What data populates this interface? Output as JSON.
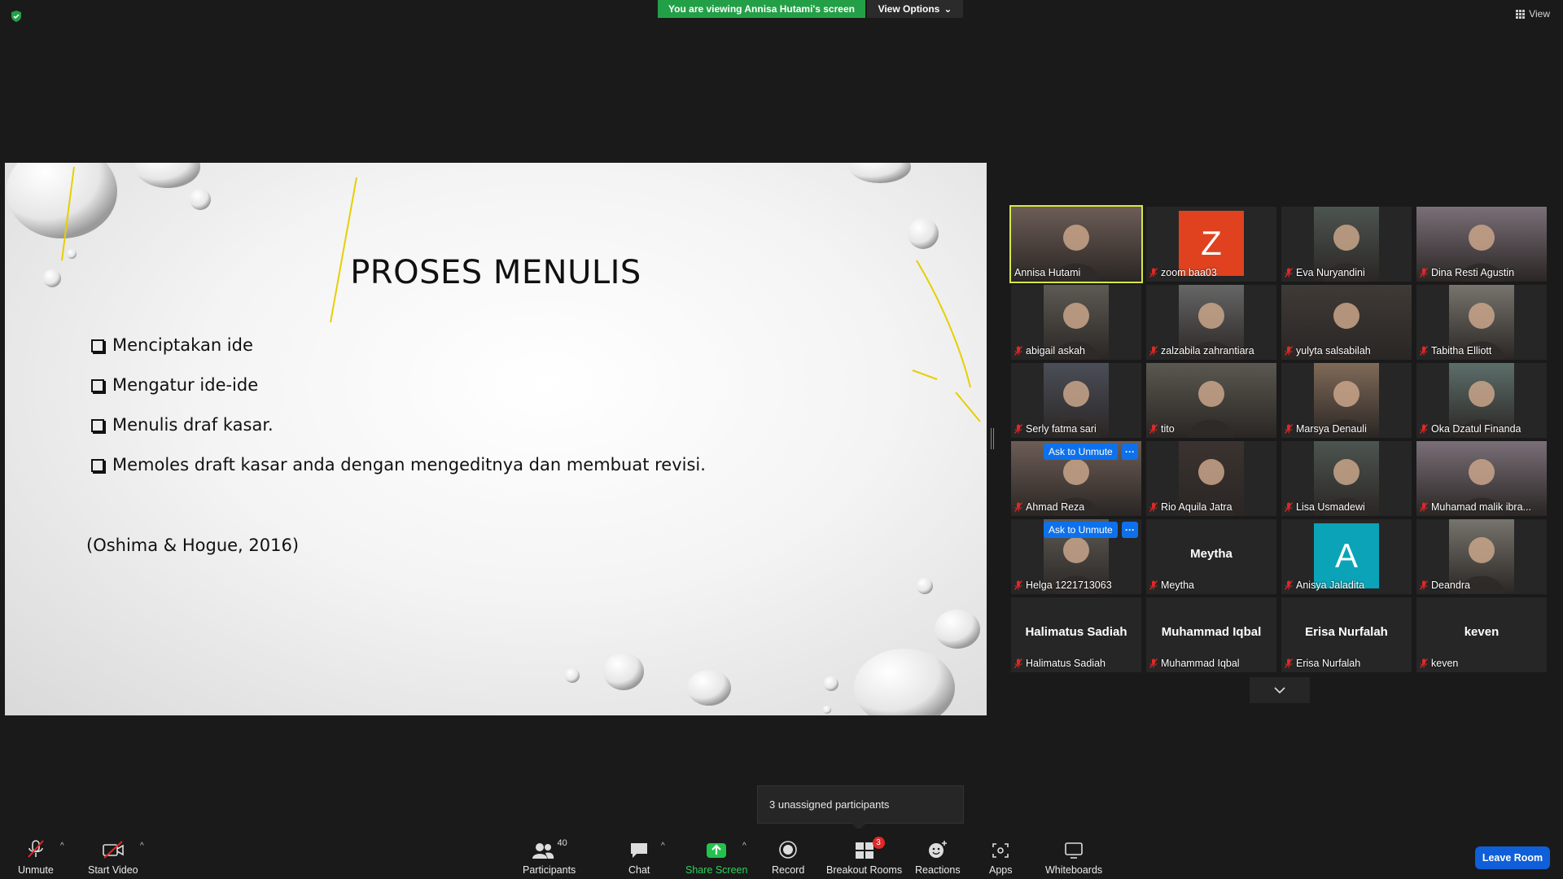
{
  "banner": {
    "viewing": "You are viewing Annisa Hutami's screen",
    "view_options": "View Options",
    "view": "View"
  },
  "slide": {
    "title": "PROSES MENULIS",
    "items": [
      "Menciptakan ide",
      "Mengatur ide-ide",
      "Menulis draf kasar.",
      "Memoles draft kasar anda dengan mengeditnya dan membuat revisi."
    ],
    "citation": "(Oshima & Hogue, 2016)"
  },
  "participants": [
    {
      "name": "Annisa Hutami",
      "kind": "video",
      "active": true
    },
    {
      "name": "zoom baa03",
      "kind": "avatar",
      "letter": "Z",
      "color": "#e0421f"
    },
    {
      "name": "Eva Nuryandini",
      "kind": "video"
    },
    {
      "name": "Dina Resti Agustin",
      "kind": "video"
    },
    {
      "name": "abigail askah",
      "kind": "video"
    },
    {
      "name": "zalzabila zahrantiara",
      "kind": "video"
    },
    {
      "name": "yulyta salsabilah",
      "kind": "video"
    },
    {
      "name": "Tabitha Elliott",
      "kind": "video"
    },
    {
      "name": "Serly fatma sari",
      "kind": "video"
    },
    {
      "name": "tito",
      "kind": "video"
    },
    {
      "name": "Marsya Denauli",
      "kind": "video"
    },
    {
      "name": "Oka Dzatul Finanda",
      "kind": "video"
    },
    {
      "name": "Ahmad Reza",
      "kind": "video",
      "ask_unmute": true
    },
    {
      "name": "Rio Aquila Jatra",
      "kind": "video"
    },
    {
      "name": "Lisa Usmadewi",
      "kind": "video"
    },
    {
      "name": "Muhamad malik ibra...",
      "kind": "video"
    },
    {
      "name": "Helga 1221713063",
      "kind": "video",
      "ask_unmute": true
    },
    {
      "name": "Meytha",
      "kind": "text",
      "display": "Meytha"
    },
    {
      "name": "Anisya Jaladita",
      "kind": "avatar",
      "letter": "A",
      "color": "#0ba3b8"
    },
    {
      "name": "Deandra",
      "kind": "video"
    },
    {
      "name": "Halimatus Sadiah",
      "kind": "text",
      "display": "Halimatus Sadiah"
    },
    {
      "name": "Muhammad Iqbal",
      "kind": "text",
      "display": "Muhammad Iqbal"
    },
    {
      "name": "Erisa Nurfalah",
      "kind": "text",
      "display": "Erisa Nurfalah"
    },
    {
      "name": "keven",
      "kind": "text",
      "display": "keven"
    }
  ],
  "ask_unmute_label": "Ask to Unmute",
  "more_label": "···",
  "tooltip": {
    "unassigned": "3 unassigned participants"
  },
  "toolbar": {
    "unmute": "Unmute",
    "start_video": "Start Video",
    "participants": "Participants",
    "participants_count": "40",
    "chat": "Chat",
    "share_screen": "Share Screen",
    "record": "Record",
    "breakout_rooms": "Breakout Rooms",
    "breakout_badge": "3",
    "reactions": "Reactions",
    "apps": "Apps",
    "whiteboards": "Whiteboards",
    "leave_room": "Leave Room"
  },
  "colors": {
    "banner_green": "#23a047",
    "accent_blue": "#0e71eb",
    "active_border": "#d6e64a",
    "muted_red": "#e02828"
  }
}
